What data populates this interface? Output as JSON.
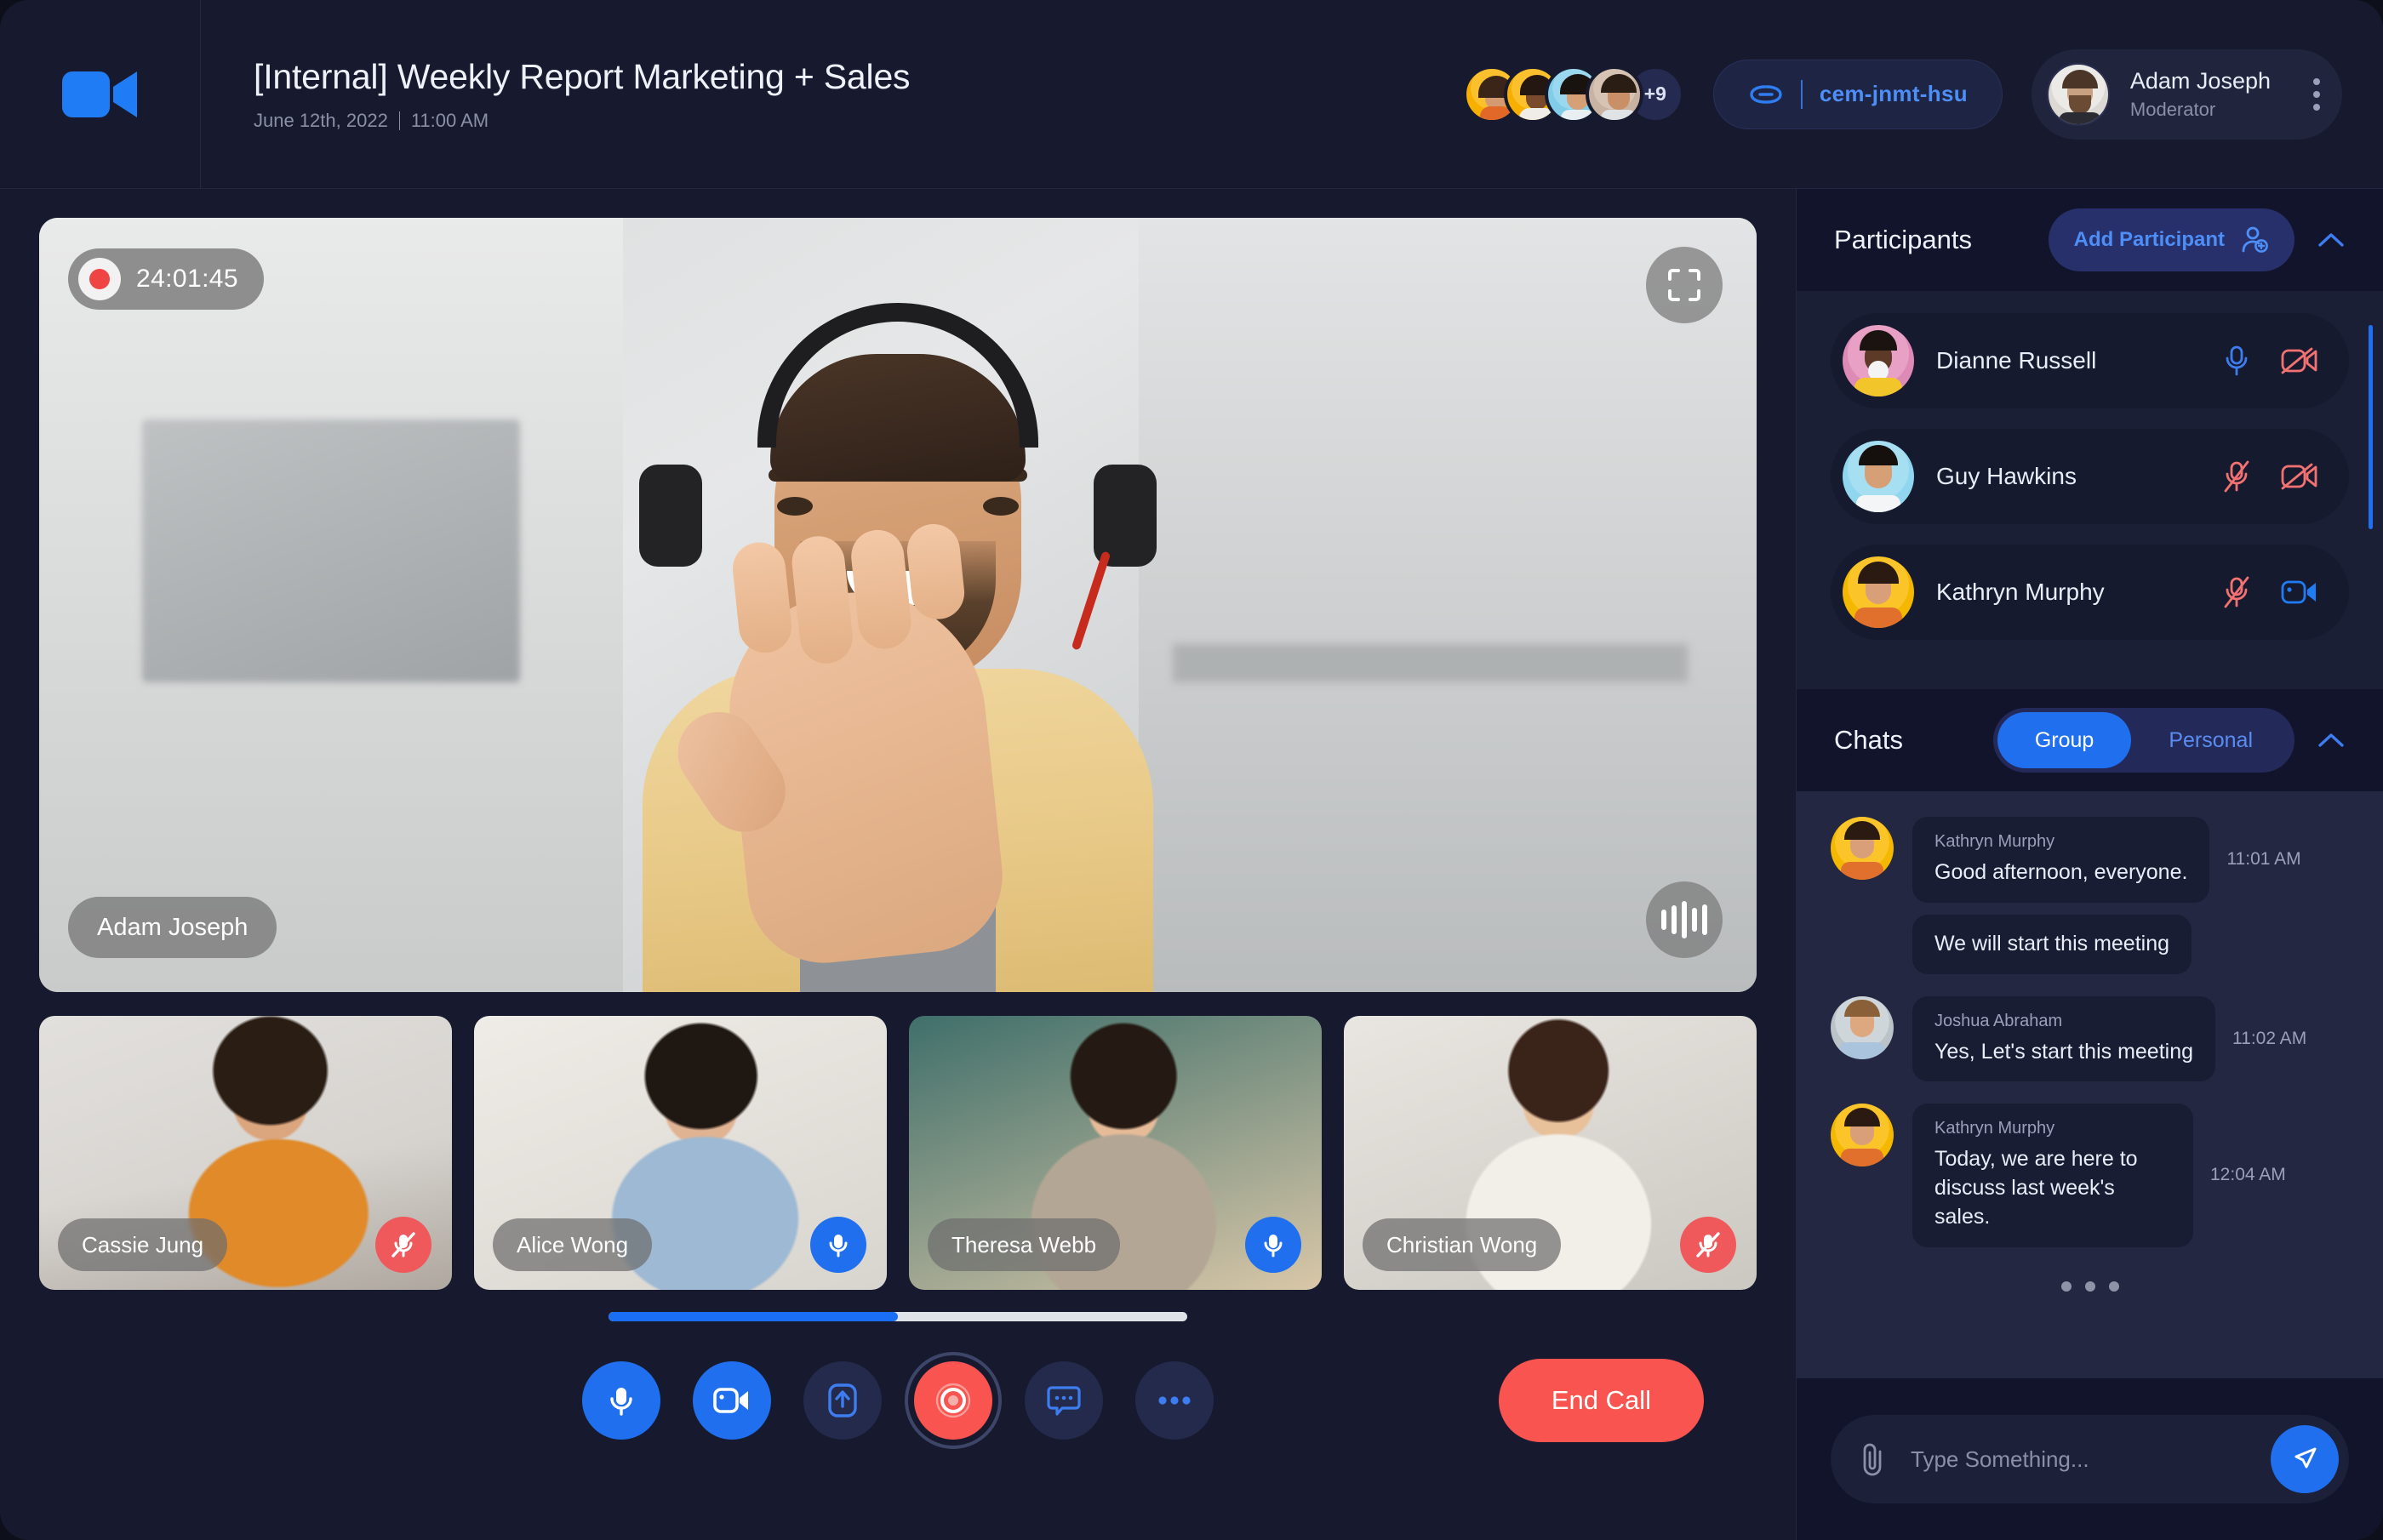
{
  "header": {
    "logo_icon": "video-camera-logo",
    "title": "[Internal] Weekly Report Marketing + Sales",
    "date": "June 12th, 2022",
    "time": "11:00 AM",
    "avatar_overflow": "+9",
    "meeting_id": "cem-jnmt-hsu",
    "link_icon": "link-icon",
    "profile": {
      "name": "Adam Joseph",
      "role": "Moderator",
      "menu_icon": "kebab-menu-icon"
    }
  },
  "main_video": {
    "recording_time": "24:01:45",
    "recording_icon": "record-dot-icon",
    "expand_icon": "fullscreen-icon",
    "audio_icon": "audio-waveform-icon",
    "speaker_name": "Adam Joseph"
  },
  "thumbnails": [
    {
      "name": "Cassie Jung",
      "mic": "muted",
      "mic_icon": "mic-off-icon"
    },
    {
      "name": "Alice Wong",
      "mic": "on",
      "mic_icon": "mic-on-icon"
    },
    {
      "name": "Theresa Webb",
      "mic": "on",
      "mic_icon": "mic-on-icon"
    },
    {
      "name": "Christian Wong",
      "mic": "muted",
      "mic_icon": "mic-off-icon"
    }
  ],
  "filmstrip": {
    "scroll_percent": 50
  },
  "controls": {
    "mic": {
      "icon": "mic-icon",
      "state": "on"
    },
    "camera": {
      "icon": "video-camera-icon",
      "state": "on"
    },
    "share": {
      "icon": "share-screen-icon",
      "state": "off"
    },
    "record": {
      "icon": "record-icon",
      "state": "recording"
    },
    "chat": {
      "icon": "chat-bubble-icon",
      "state": "off"
    },
    "more": {
      "icon": "more-dots-icon",
      "state": "off"
    },
    "end_call_label": "End Call"
  },
  "participants_panel": {
    "title": "Participants",
    "add_label": "Add Participant",
    "add_icon": "add-user-icon",
    "collapse_icon": "chevron-up-icon",
    "items": [
      {
        "name": "Dianne Russell",
        "mic": "on",
        "camera": "off"
      },
      {
        "name": "Guy Hawkins",
        "mic": "off",
        "camera": "off"
      },
      {
        "name": "Kathryn Murphy",
        "mic": "off",
        "camera": "on"
      }
    ]
  },
  "chats_panel": {
    "title": "Chats",
    "tabs": [
      {
        "label": "Group",
        "active": true
      },
      {
        "label": "Personal",
        "active": false
      }
    ],
    "collapse_icon": "chevron-up-icon",
    "messages": [
      {
        "sender": "Kathryn Murphy",
        "time": "11:01 AM",
        "texts": [
          "Good afternoon, everyone.",
          "We will start this meeting"
        ]
      },
      {
        "sender": "Joshua Abraham",
        "time": "11:02 AM",
        "texts": [
          "Yes, Let's start this meeting"
        ]
      },
      {
        "sender": "Kathryn Murphy",
        "time": "12:04 AM",
        "texts": [
          "Today, we are here to discuss last week's sales."
        ]
      }
    ],
    "input_placeholder": "Type Something...",
    "attach_icon": "paperclip-icon",
    "send_icon": "send-icon"
  },
  "colors": {
    "accent_blue": "#1f6fef",
    "danger_red": "#f9544f",
    "panel_dark": "#11142a",
    "app_bg": "#171a2e",
    "chat_bg": "#232741"
  }
}
